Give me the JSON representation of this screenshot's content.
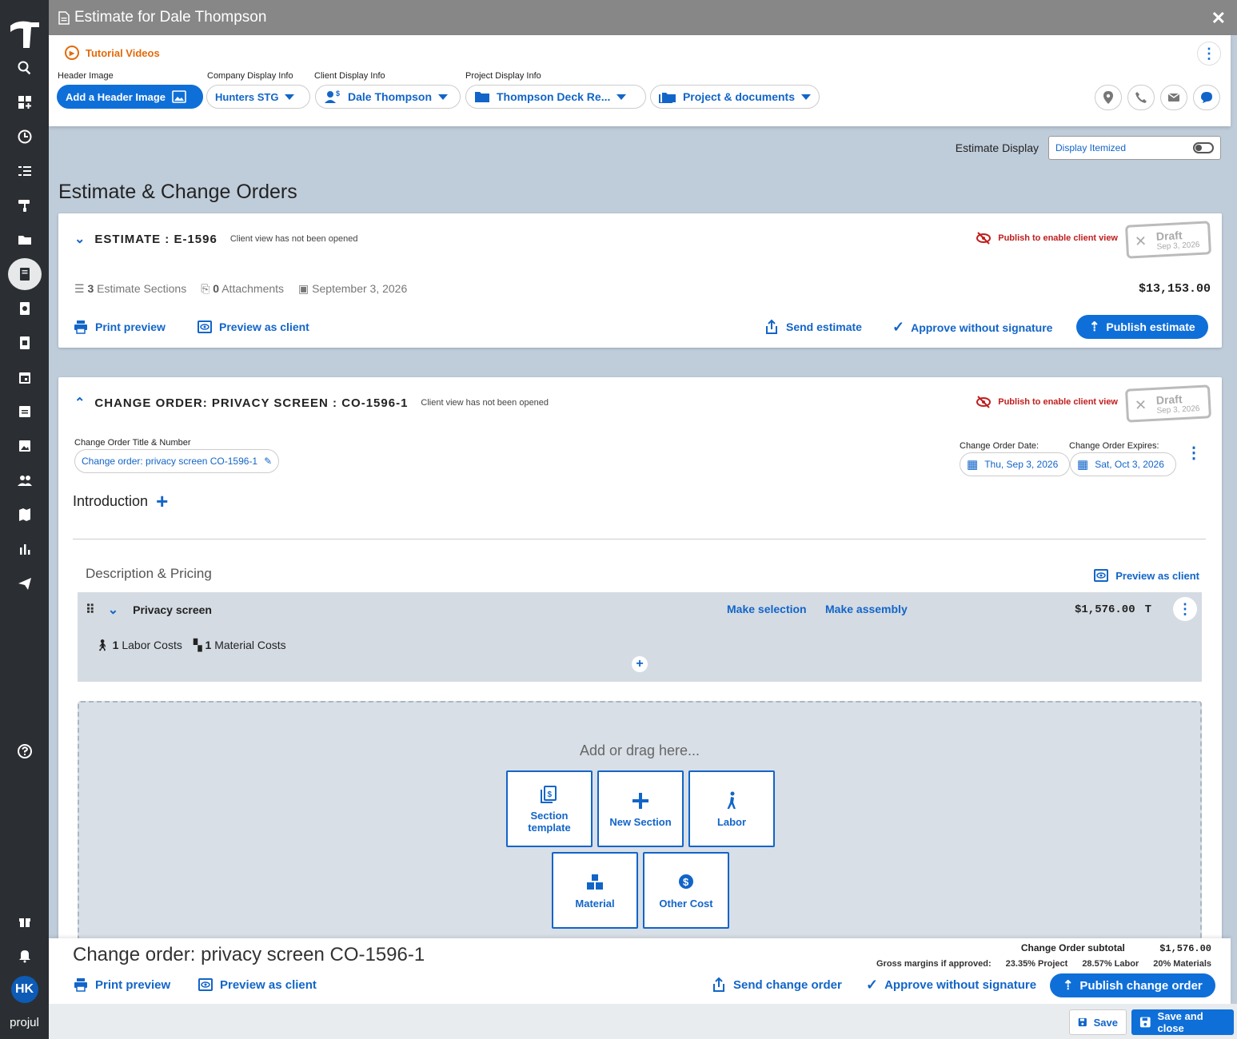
{
  "window": {
    "title": "Estimate for Dale Thompson"
  },
  "header": {
    "tutorial": "Tutorial Videos",
    "header_image_label": "Header Image",
    "header_image_btn": "Add a Header Image",
    "company_label": "Company Display Info",
    "company_value": "Hunters STG",
    "client_label": "Client Display Info",
    "client_value": "Dale Thompson",
    "project_label": "Project Display Info",
    "project_value": "Thompson Deck Re...",
    "documents_value": "Project & documents"
  },
  "display": {
    "label": "Estimate Display",
    "value": "Display Itemized"
  },
  "page_title": "Estimate & Change Orders",
  "estimate": {
    "title": "ESTIMATE : E-1596",
    "sub": "Client view has not been opened",
    "publish_warn": "Publish to enable client view",
    "stamp_status": "Draft",
    "stamp_date": "Sep 3, 2026",
    "sections_count": "3",
    "sections_label": "Estimate Sections",
    "attachments_count": "0",
    "attachments_label": "Attachments",
    "date": "September 3, 2026",
    "total": "$13,153.00",
    "print_preview": "Print preview",
    "preview_client": "Preview as client",
    "send": "Send estimate",
    "approve": "Approve without signature",
    "publish": "Publish estimate"
  },
  "change_order": {
    "title": "CHANGE ORDER: PRIVACY SCREEN : CO-1596-1",
    "sub": "Client view has not been opened",
    "publish_warn": "Publish to enable client view",
    "stamp_status": "Draft",
    "stamp_date": "Sep 3, 2026",
    "title_label": "Change Order Title & Number",
    "title_value": "Change order: privacy screen CO-1596-1",
    "date_label": "Change Order Date:",
    "date_value": "Thu, Sep 3, 2026",
    "expires_label": "Change Order Expires:",
    "expires_value": "Sat, Oct 3, 2026",
    "introduction": "Introduction",
    "desc_pricing": "Description & Pricing",
    "preview_client": "Preview as client",
    "section_name": "Privacy screen",
    "make_selection": "Make selection",
    "make_assembly": "Make assembly",
    "section_total": "$1,576.00",
    "tax_flag": "T",
    "labor_count": "1",
    "labor_label": "Labor Costs",
    "material_count": "1",
    "material_label": "Material Costs",
    "dropzone": "Add or drag here...",
    "tiles": {
      "section_template": "Section template",
      "new_section": "New Section",
      "labor": "Labor",
      "material": "Material",
      "other_cost": "Other Cost"
    }
  },
  "footer": {
    "title": "Change order: privacy screen CO-1596-1",
    "subtotal_label": "Change Order subtotal",
    "subtotal_value": "$1,576.00",
    "margins_label": "Gross margins if approved:",
    "margin_project": "23.35% Project",
    "margin_labor": "28.57% Labor",
    "margin_materials": "20% Materials",
    "print_preview": "Print preview",
    "preview_client": "Preview as client",
    "send": "Send change order",
    "approve": "Approve without signature",
    "publish": "Publish change order"
  },
  "bottom": {
    "save": "Save",
    "save_close": "Save and close"
  },
  "user": {
    "initials": "HK"
  },
  "brand": "projul",
  "colors": {
    "accent": "#0f6fd8",
    "warning": "#c01e1e",
    "tutorial": "#e36a0a"
  }
}
